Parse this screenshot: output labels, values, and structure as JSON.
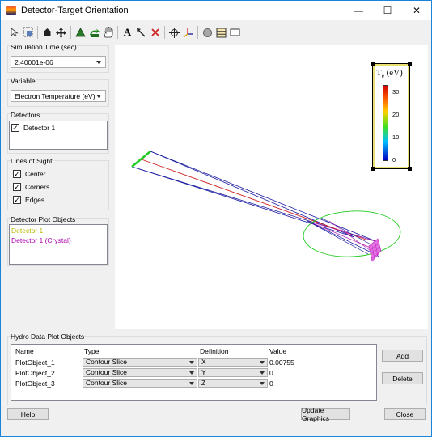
{
  "window": {
    "title": "Detector-Target Orientation",
    "minimize": "—",
    "maximize": "☐",
    "close": "✕"
  },
  "toolbar": {
    "icons": [
      "pointer-icon",
      "select-box-icon",
      "home-icon",
      "pan-icon",
      "triangle-icon",
      "rotate-icon",
      "hand-icon",
      "text-icon",
      "arrow-icon",
      "delete-icon",
      "crosshair-icon",
      "axes-icon",
      "circle-icon",
      "grid-icon",
      "frame-icon"
    ]
  },
  "sim_time": {
    "label": "Simulation Time (sec)",
    "value": "2.40001e-06"
  },
  "variable": {
    "label": "Variable",
    "value": "Electron Temperature (eV)"
  },
  "detectors": {
    "label": "Detectors",
    "items": [
      {
        "label": "Detector 1",
        "checked": true
      }
    ]
  },
  "lines_of_sight": {
    "label": "Lines of Sight",
    "items": [
      {
        "label": "Center"
      },
      {
        "label": "Corners"
      },
      {
        "label": "Edges"
      }
    ]
  },
  "plot_objects": {
    "label": "Detector Plot Objects",
    "items": [
      {
        "label": "Detector 1",
        "color": "#b8b800"
      },
      {
        "label": "Detector 1 (Crystal)",
        "color": "#b000b0"
      }
    ]
  },
  "colorbar": {
    "title": "T",
    "subscript": "e",
    "unit": " (eV)",
    "ticks": [
      "30",
      "20",
      "10",
      "0"
    ]
  },
  "hydro": {
    "label": "Hydro Data Plot Objects",
    "headers": {
      "name": "Name",
      "type": "Type",
      "definition": "Definition",
      "value": "Value"
    },
    "rows": [
      {
        "name": "PlotObject_1",
        "type": "Contour Slice",
        "definition": "X",
        "value": "0.00755"
      },
      {
        "name": "PlotObject_2",
        "type": "Contour Slice",
        "definition": "Y",
        "value": "0"
      },
      {
        "name": "PlotObject_3",
        "type": "Contour Slice",
        "definition": "Z",
        "value": "0"
      }
    ],
    "add": "Add",
    "delete": "Delete"
  },
  "footer": {
    "help": "Help",
    "update": "Update Graphics",
    "close": "Close"
  },
  "colors": {
    "accent": "#1883d7",
    "blue_line": "#1a1aa0",
    "red_line": "#d02020",
    "green": "#22cc22",
    "magenta": "#d020d0"
  }
}
